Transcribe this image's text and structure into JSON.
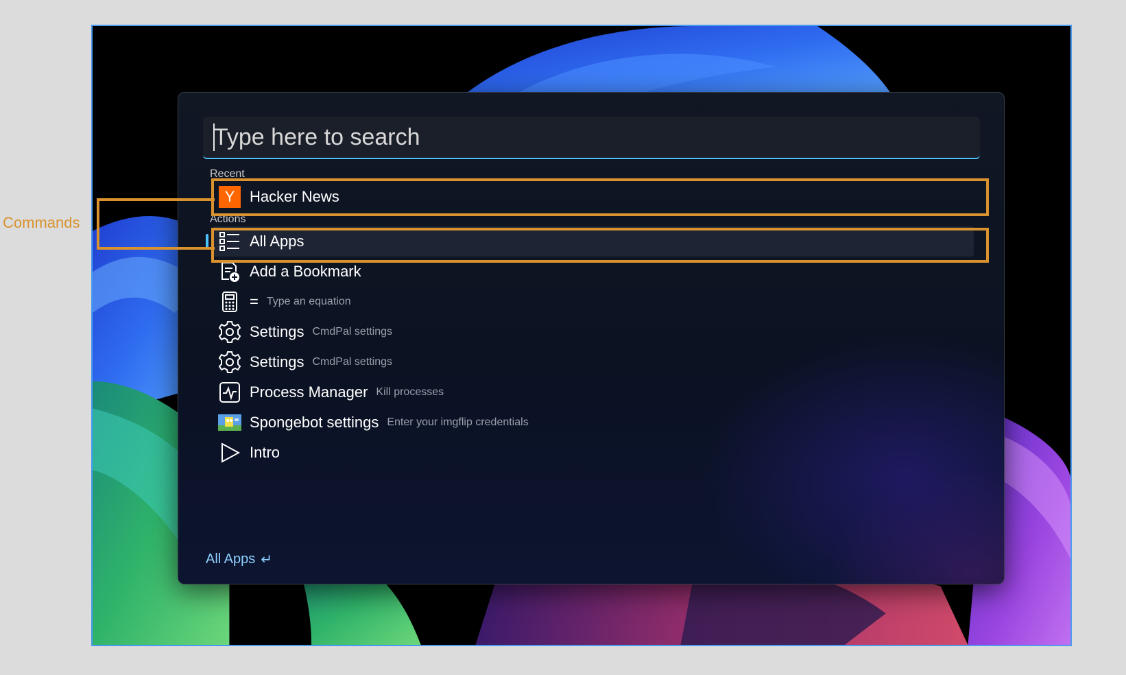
{
  "search": {
    "placeholder": "Type here to search",
    "value": ""
  },
  "sections": {
    "recent": "Recent",
    "actions": "Actions"
  },
  "recent_items": [
    {
      "title": "Hacker News",
      "icon": "hacker-news-logo",
      "icon_letter": "Y"
    }
  ],
  "action_items": [
    {
      "title": "All Apps",
      "subtitle": "",
      "icon": "list-icon",
      "selected": true
    },
    {
      "title": "Add a Bookmark",
      "subtitle": "",
      "icon": "bookmark-add-icon"
    },
    {
      "title": "=",
      "subtitle": "Type an equation",
      "icon": "calculator-icon"
    },
    {
      "title": "Settings",
      "subtitle": "CmdPal settings",
      "icon": "gear-icon"
    },
    {
      "title": "Settings",
      "subtitle": "CmdPal settings",
      "icon": "gear-icon"
    },
    {
      "title": "Process Manager",
      "subtitle": "Kill processes",
      "icon": "activity-monitor-icon"
    },
    {
      "title": "Spongebot settings",
      "subtitle": "Enter your imgflip credentials",
      "icon": "spongebot-image-icon"
    },
    {
      "title": "Intro",
      "subtitle": "",
      "icon": "play-icon"
    }
  ],
  "footer": {
    "label": "All Apps",
    "icon": "enter-key-icon",
    "glyph": "↵"
  },
  "annotation": {
    "label": "Commands"
  },
  "colors": {
    "accent": "#4cc2ff",
    "callout": "#d9922e",
    "hn_orange": "#ff6600"
  }
}
